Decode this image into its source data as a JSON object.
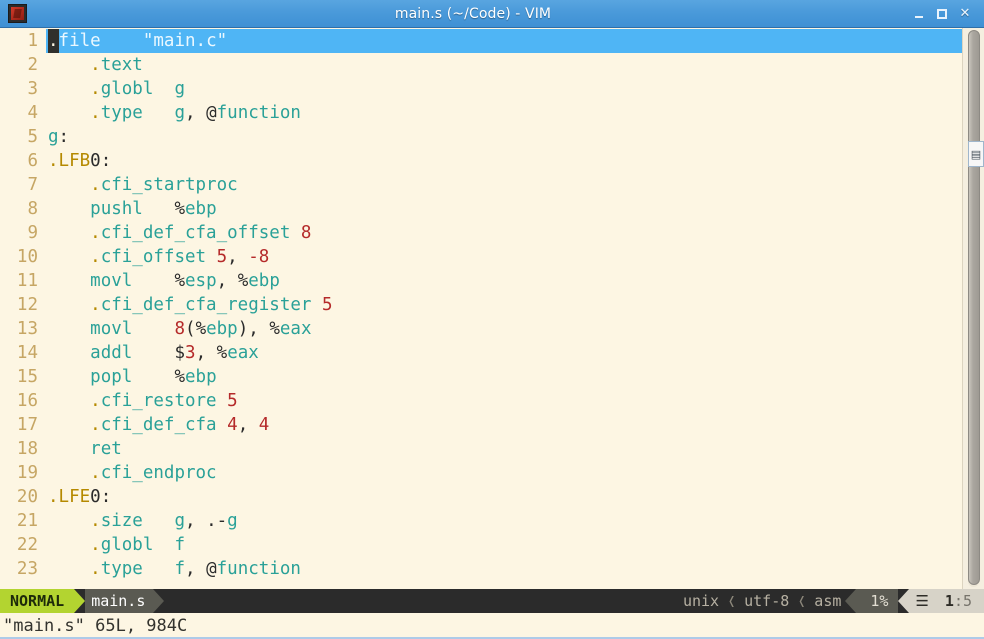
{
  "window": {
    "title": "main.s (~/Code) - VIM",
    "icon": "vim-icon",
    "minimize_label": "",
    "maximize_label": "",
    "close_label": "✕"
  },
  "editor": {
    "cursor_char": ".",
    "lines": [
      {
        "n": "1",
        "tokens": [
          {
            "t": ".",
            "c": "cursor"
          },
          {
            "t": "file",
            "c": "s-dir2"
          },
          {
            "t": "    ",
            "c": "s-pun"
          },
          {
            "t": "\"main.c\"",
            "c": "s-str"
          }
        ]
      },
      {
        "n": "2",
        "tokens": [
          {
            "t": "    ",
            "c": "s-pun"
          },
          {
            "t": ".",
            "c": "s-dir"
          },
          {
            "t": "text",
            "c": "s-dir2"
          }
        ]
      },
      {
        "n": "3",
        "tokens": [
          {
            "t": "    ",
            "c": "s-pun"
          },
          {
            "t": ".",
            "c": "s-dir"
          },
          {
            "t": "globl",
            "c": "s-dir2"
          },
          {
            "t": "  ",
            "c": "s-pun"
          },
          {
            "t": "g",
            "c": "s-lbl"
          }
        ]
      },
      {
        "n": "4",
        "tokens": [
          {
            "t": "    ",
            "c": "s-pun"
          },
          {
            "t": ".",
            "c": "s-dir"
          },
          {
            "t": "type",
            "c": "s-dir2"
          },
          {
            "t": "   ",
            "c": "s-pun"
          },
          {
            "t": "g",
            "c": "s-lbl"
          },
          {
            "t": ", ",
            "c": "s-pun"
          },
          {
            "t": "@",
            "c": "s-pun"
          },
          {
            "t": "function",
            "c": "s-type"
          }
        ]
      },
      {
        "n": "5",
        "tokens": [
          {
            "t": "g",
            "c": "s-lbl"
          },
          {
            "t": ":",
            "c": "s-pun"
          }
        ]
      },
      {
        "n": "6",
        "tokens": [
          {
            "t": ".LFB",
            "c": "s-dir"
          },
          {
            "t": "0",
            "c": "s-pun"
          },
          {
            "t": ":",
            "c": "s-pun"
          }
        ]
      },
      {
        "n": "7",
        "tokens": [
          {
            "t": "    ",
            "c": "s-pun"
          },
          {
            "t": ".",
            "c": "s-dir"
          },
          {
            "t": "cfi_startproc",
            "c": "s-dir2"
          }
        ]
      },
      {
        "n": "8",
        "tokens": [
          {
            "t": "    ",
            "c": "s-pun"
          },
          {
            "t": "pushl",
            "c": "s-op"
          },
          {
            "t": "   ",
            "c": "s-pun"
          },
          {
            "t": "%",
            "c": "s-pun"
          },
          {
            "t": "ebp",
            "c": "s-lbl"
          }
        ]
      },
      {
        "n": "9",
        "tokens": [
          {
            "t": "    ",
            "c": "s-pun"
          },
          {
            "t": ".",
            "c": "s-dir"
          },
          {
            "t": "cfi_def_cfa_offset",
            "c": "s-dir2"
          },
          {
            "t": " ",
            "c": "s-pun"
          },
          {
            "t": "8",
            "c": "s-num"
          }
        ]
      },
      {
        "n": "10",
        "tokens": [
          {
            "t": "    ",
            "c": "s-pun"
          },
          {
            "t": ".",
            "c": "s-dir"
          },
          {
            "t": "cfi_offset",
            "c": "s-dir2"
          },
          {
            "t": " ",
            "c": "s-pun"
          },
          {
            "t": "5",
            "c": "s-num"
          },
          {
            "t": ", ",
            "c": "s-pun"
          },
          {
            "t": "-8",
            "c": "s-num"
          }
        ]
      },
      {
        "n": "11",
        "tokens": [
          {
            "t": "    ",
            "c": "s-pun"
          },
          {
            "t": "movl",
            "c": "s-op"
          },
          {
            "t": "    ",
            "c": "s-pun"
          },
          {
            "t": "%",
            "c": "s-pun"
          },
          {
            "t": "esp",
            "c": "s-lbl"
          },
          {
            "t": ", ",
            "c": "s-pun"
          },
          {
            "t": "%",
            "c": "s-pun"
          },
          {
            "t": "ebp",
            "c": "s-lbl"
          }
        ]
      },
      {
        "n": "12",
        "tokens": [
          {
            "t": "    ",
            "c": "s-pun"
          },
          {
            "t": ".",
            "c": "s-dir"
          },
          {
            "t": "cfi_def_cfa_register",
            "c": "s-dir2"
          },
          {
            "t": " ",
            "c": "s-pun"
          },
          {
            "t": "5",
            "c": "s-num"
          }
        ]
      },
      {
        "n": "13",
        "tokens": [
          {
            "t": "    ",
            "c": "s-pun"
          },
          {
            "t": "movl",
            "c": "s-op"
          },
          {
            "t": "    ",
            "c": "s-pun"
          },
          {
            "t": "8",
            "c": "s-num"
          },
          {
            "t": "(",
            "c": "s-pun"
          },
          {
            "t": "%",
            "c": "s-pun"
          },
          {
            "t": "ebp",
            "c": "s-lbl"
          },
          {
            "t": "), ",
            "c": "s-pun"
          },
          {
            "t": "%",
            "c": "s-pun"
          },
          {
            "t": "eax",
            "c": "s-lbl"
          }
        ]
      },
      {
        "n": "14",
        "tokens": [
          {
            "t": "    ",
            "c": "s-pun"
          },
          {
            "t": "addl",
            "c": "s-op"
          },
          {
            "t": "    ",
            "c": "s-pun"
          },
          {
            "t": "$",
            "c": "s-pun"
          },
          {
            "t": "3",
            "c": "s-num"
          },
          {
            "t": ", ",
            "c": "s-pun"
          },
          {
            "t": "%",
            "c": "s-pun"
          },
          {
            "t": "eax",
            "c": "s-lbl"
          }
        ]
      },
      {
        "n": "15",
        "tokens": [
          {
            "t": "    ",
            "c": "s-pun"
          },
          {
            "t": "popl",
            "c": "s-op"
          },
          {
            "t": "    ",
            "c": "s-pun"
          },
          {
            "t": "%",
            "c": "s-pun"
          },
          {
            "t": "ebp",
            "c": "s-lbl"
          }
        ]
      },
      {
        "n": "16",
        "tokens": [
          {
            "t": "    ",
            "c": "s-pun"
          },
          {
            "t": ".",
            "c": "s-dir"
          },
          {
            "t": "cfi_restore",
            "c": "s-dir2"
          },
          {
            "t": " ",
            "c": "s-pun"
          },
          {
            "t": "5",
            "c": "s-num"
          }
        ]
      },
      {
        "n": "17",
        "tokens": [
          {
            "t": "    ",
            "c": "s-pun"
          },
          {
            "t": ".",
            "c": "s-dir"
          },
          {
            "t": "cfi_def_cfa",
            "c": "s-dir2"
          },
          {
            "t": " ",
            "c": "s-pun"
          },
          {
            "t": "4",
            "c": "s-num"
          },
          {
            "t": ", ",
            "c": "s-pun"
          },
          {
            "t": "4",
            "c": "s-num"
          }
        ]
      },
      {
        "n": "18",
        "tokens": [
          {
            "t": "    ",
            "c": "s-pun"
          },
          {
            "t": "ret",
            "c": "s-op"
          }
        ]
      },
      {
        "n": "19",
        "tokens": [
          {
            "t": "    ",
            "c": "s-pun"
          },
          {
            "t": ".",
            "c": "s-dir"
          },
          {
            "t": "cfi_endproc",
            "c": "s-dir2"
          }
        ]
      },
      {
        "n": "20",
        "tokens": [
          {
            "t": ".LFE",
            "c": "s-dir"
          },
          {
            "t": "0",
            "c": "s-pun"
          },
          {
            "t": ":",
            "c": "s-pun"
          }
        ]
      },
      {
        "n": "21",
        "tokens": [
          {
            "t": "    ",
            "c": "s-pun"
          },
          {
            "t": ".",
            "c": "s-dir"
          },
          {
            "t": "size",
            "c": "s-dir2"
          },
          {
            "t": "   ",
            "c": "s-pun"
          },
          {
            "t": "g",
            "c": "s-lbl"
          },
          {
            "t": ", ",
            "c": "s-pun"
          },
          {
            "t": ".-",
            "c": "s-pun"
          },
          {
            "t": "g",
            "c": "s-lbl"
          }
        ]
      },
      {
        "n": "22",
        "tokens": [
          {
            "t": "    ",
            "c": "s-pun"
          },
          {
            "t": ".",
            "c": "s-dir"
          },
          {
            "t": "globl",
            "c": "s-dir2"
          },
          {
            "t": "  ",
            "c": "s-pun"
          },
          {
            "t": "f",
            "c": "s-lbl"
          }
        ]
      },
      {
        "n": "23",
        "tokens": [
          {
            "t": "    ",
            "c": "s-pun"
          },
          {
            "t": ".",
            "c": "s-dir"
          },
          {
            "t": "type",
            "c": "s-dir2"
          },
          {
            "t": "   ",
            "c": "s-pun"
          },
          {
            "t": "f",
            "c": "s-lbl"
          },
          {
            "t": ", ",
            "c": "s-pun"
          },
          {
            "t": "@",
            "c": "s-pun"
          },
          {
            "t": "function",
            "c": "s-type"
          }
        ]
      }
    ]
  },
  "floating_widget": {
    "label": "▤"
  },
  "statusline": {
    "mode": "NORMAL",
    "filename": "main.s",
    "fileformat": "unix",
    "encoding": "utf-8",
    "filetype": "asm",
    "percent": "1%",
    "line_glyph": "☰",
    "position_line": "1",
    "position_sep": ":",
    "position_col": "5",
    "chevron": "❬"
  },
  "cmdline": {
    "message": "\"main.s\" 65L, 984C"
  },
  "colors": {
    "background": "#fdf6e3",
    "titlebar": "#4a9ada",
    "cursorline": "#4fb5f5",
    "mode_badge": "#b3d430",
    "statusline": "#2b2b2b",
    "linenumber": "#c6a664",
    "directive": "#b58900",
    "keyword": "#2aa198",
    "number": "#b52a2a"
  }
}
